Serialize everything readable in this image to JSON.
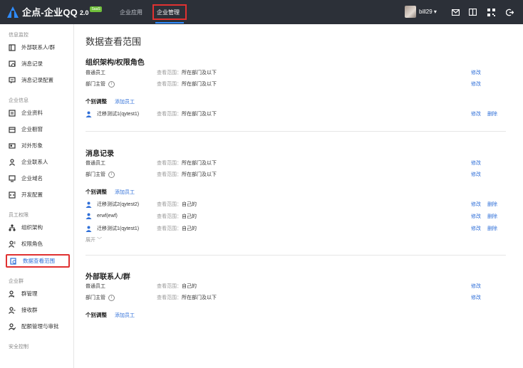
{
  "topbar": {
    "brand": "企点-企业QQ",
    "version": "2.0",
    "badge": "SaaS",
    "nav": [
      "企业应用",
      "企业管理"
    ],
    "username": "bill29",
    "user_caret": "▾"
  },
  "sidebar": {
    "groups": [
      {
        "title": "信息监控",
        "items": [
          "外部联系人/群",
          "消息记录",
          "消息记录配置"
        ]
      },
      {
        "title": "企业信息",
        "items": [
          "企业资料",
          "企业橱窗",
          "对外形象",
          "企业联系人",
          "企业域名",
          "开发配置"
        ]
      },
      {
        "title": "员工权限",
        "items": [
          "组织架构",
          "权限角色",
          "数据查看范围"
        ]
      },
      {
        "title": "企业群",
        "items": [
          "群管理",
          "接收群",
          "配额管理与审批"
        ]
      },
      {
        "title": "安全控制",
        "items": []
      }
    ]
  },
  "main": {
    "page_title": "数据查看范围",
    "scope_prefix": "查看范围：",
    "edit": "修改",
    "delete": "删除",
    "sections": [
      {
        "title": "组织架构/权限角色",
        "rows": [
          {
            "label": "普通员工",
            "scope": "所在部门及以下",
            "info": false
          },
          {
            "label": "部门主管",
            "scope": "所在部门及以下",
            "info": true
          }
        ],
        "adjust_title": "个别调整",
        "add_label": "添加员工",
        "users": [
          {
            "name": "迁移测试1(qytest1)",
            "scope": "所在部门及以下"
          }
        ]
      },
      {
        "title": "消息记录",
        "rows": [
          {
            "label": "普通员工",
            "scope": "所在部门及以下",
            "info": false
          },
          {
            "label": "部门主管",
            "scope": "所在部门及以下",
            "info": true
          }
        ],
        "adjust_title": "个别调整",
        "add_label": "添加员工",
        "users": [
          {
            "name": "迁移测试2(qytest2)",
            "scope": "自己的"
          },
          {
            "name": "erwf(ewf)",
            "scope": "自己的"
          },
          {
            "name": "迁移测试1(qytest1)",
            "scope": "自己的"
          }
        ],
        "expand": "展开 ﹀"
      },
      {
        "title": "外部联系人/群",
        "rows": [
          {
            "label": "普通员工",
            "scope": "自己的",
            "info": false
          },
          {
            "label": "部门主管",
            "scope": "所在部门及以下",
            "info": true
          }
        ],
        "adjust_title": "个别调整",
        "add_label": "添加员工"
      }
    ]
  },
  "colors": {
    "topbar": "#2c3038",
    "accent": "#2f8cff",
    "link": "#2f6fd8",
    "highlight": "#e03131"
  }
}
